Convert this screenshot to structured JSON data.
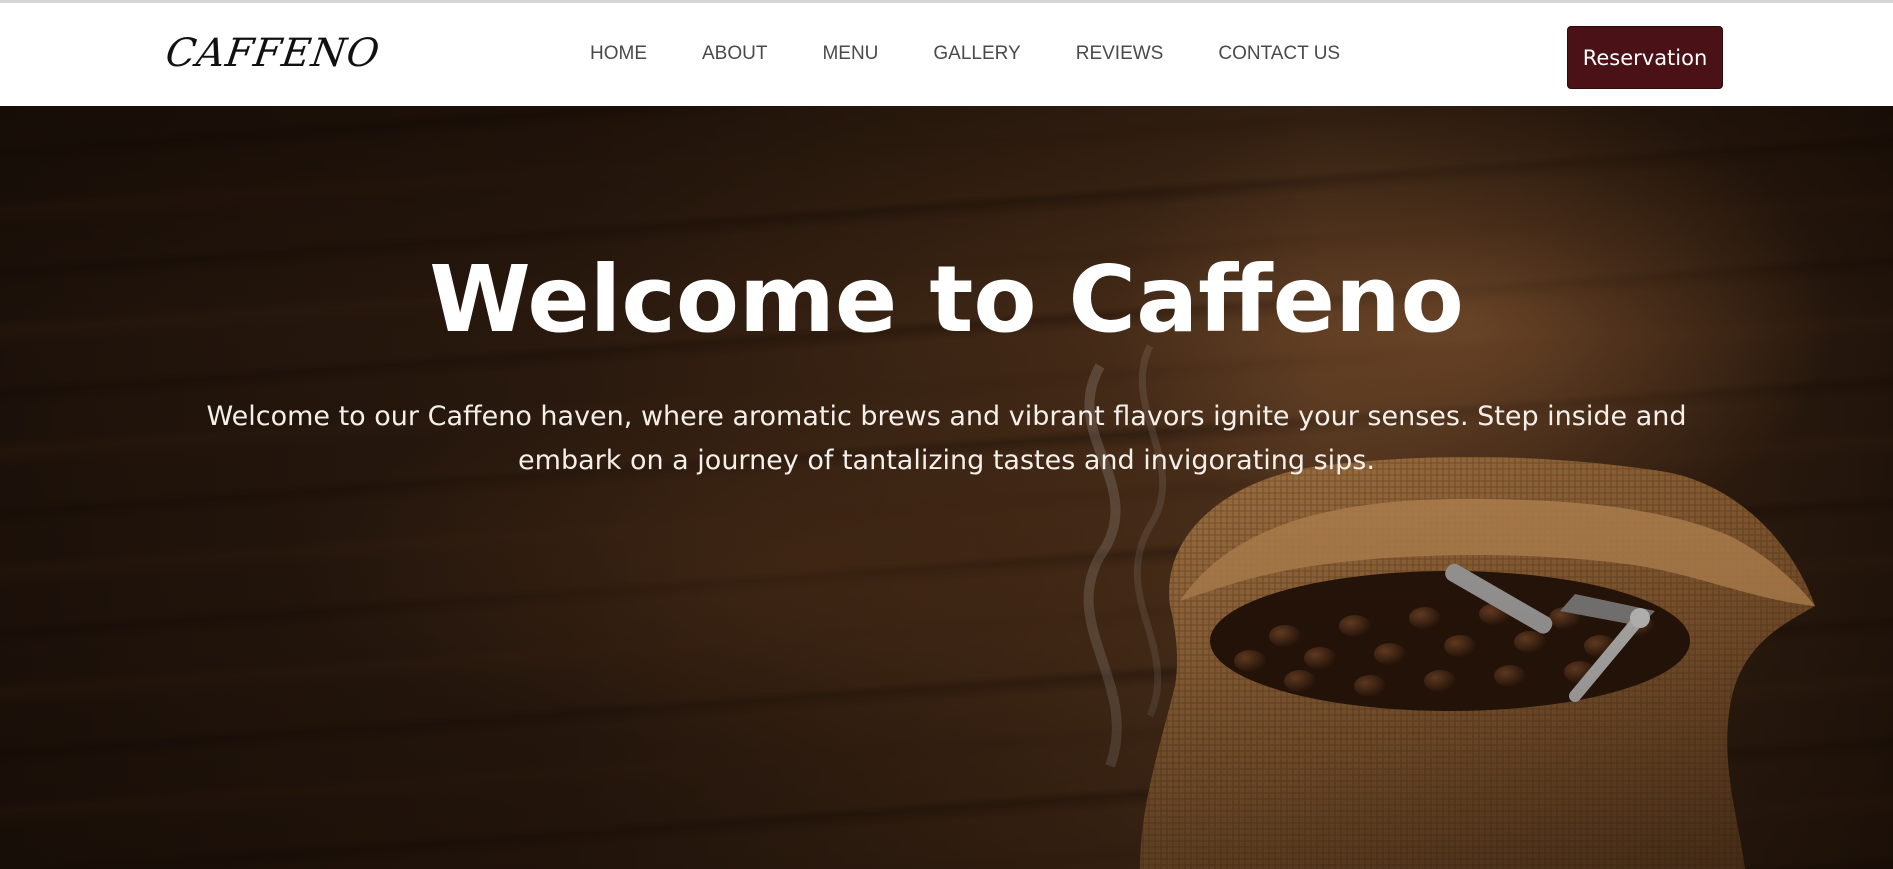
{
  "brand": {
    "logo_text": "CAFFENO"
  },
  "nav": {
    "links": [
      "HOME",
      "ABOUT",
      "MENU",
      "GALLERY",
      "REVIEWS",
      "CONTACT US"
    ],
    "reservation_label": "Reservation"
  },
  "hero": {
    "title": "Welcome to Caffeno",
    "description": "Welcome to our Caffeno haven, where aromatic brews and vibrant flavors ignite your senses. Step inside and embark on a journey of tantalizing tastes and invigorating sips.",
    "image_subject": "coffee-bean-sack-icon"
  },
  "colors": {
    "accent": "#4a1216",
    "nav_text": "#4a4a4a",
    "hero_text": "#ffffff"
  }
}
